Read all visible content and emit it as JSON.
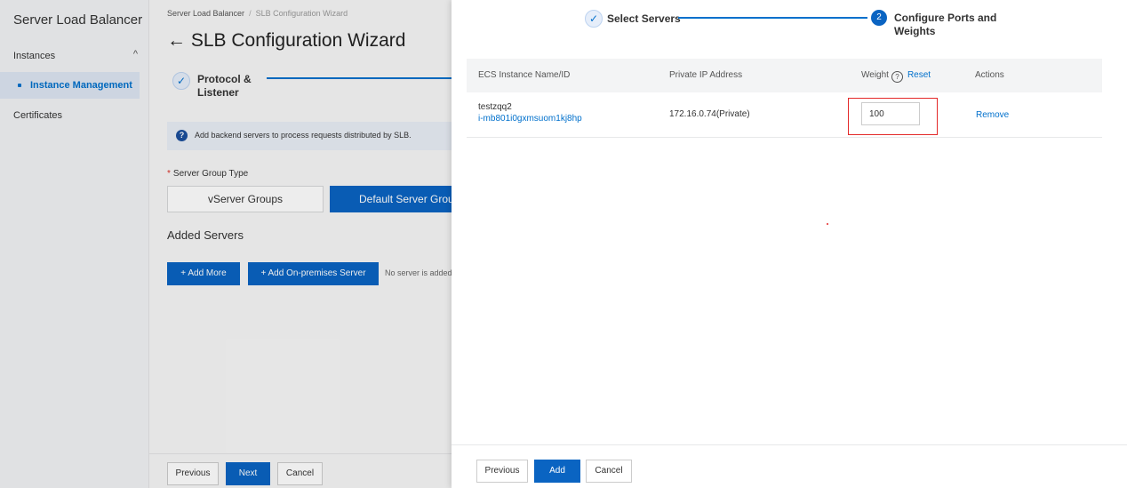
{
  "sidebar": {
    "title": "Server Load Balancer",
    "group_label": "Instances",
    "group_chevron": "^",
    "active_item": "Instance Management",
    "certificates": "Certificates"
  },
  "background": {
    "breadcrumb": [
      "Server Load Balancer",
      "/",
      "SLB Configuration Wizard"
    ],
    "page_title": "← SLB Configuration Wizard",
    "step1_icon": "✓",
    "step1_label": "Protocol & Listener",
    "info_icon": "?",
    "info_text": "Add backend servers to process requests distributed by SLB.",
    "server_group_required": "*",
    "server_group_type_label": "Server Group Type",
    "segment_vserver": "vServer Groups",
    "segment_default": "Default Server Group",
    "added_servers": "Added Servers",
    "add_more": "+ Add More",
    "add_onprem": "+ Add On-premises Server",
    "no_server": "No server is added",
    "footer": {
      "previous": "Previous",
      "next": "Next",
      "cancel": "Cancel"
    }
  },
  "drawer": {
    "steps": [
      {
        "icon": "✓",
        "label": "Select Servers",
        "status": "done"
      },
      {
        "icon": "2",
        "label": "Configure Ports and Weights",
        "status": "active"
      }
    ],
    "table": {
      "headers": {
        "name": "ECS Instance Name/ID",
        "ip": "Private IP Address",
        "weight": "Weight",
        "weight_help": "?",
        "reset": "Reset",
        "actions": "Actions"
      },
      "rows": [
        {
          "name": "testzqq2",
          "id": "i-mb801i0gxmsuom1kj8hp",
          "ip": "172.16.0.74(Private)",
          "weight": "100",
          "action": "Remove"
        }
      ]
    },
    "footer": {
      "previous": "Previous",
      "add": "Add",
      "cancel": "Cancel"
    }
  },
  "colors": {
    "primary": "#0a64c2",
    "link": "#0070cc",
    "highlight": "#e32929"
  },
  "icons": {
    "back": "arrow-left-icon",
    "check": "check-circle-icon",
    "help": "question-circle-icon",
    "info": "info-circle-icon"
  }
}
